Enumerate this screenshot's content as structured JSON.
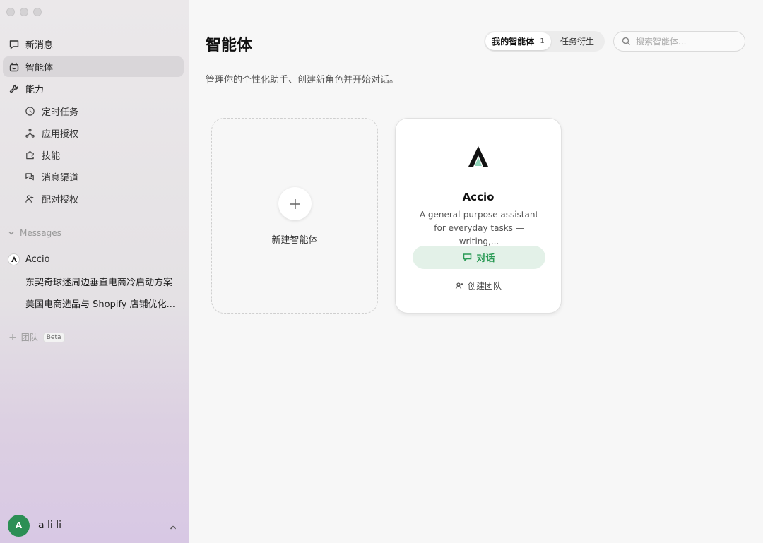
{
  "sidebar": {
    "nav": [
      {
        "label": "新消息",
        "icon": "chat-bubble-icon"
      },
      {
        "label": "智能体",
        "icon": "robot-icon",
        "active": true
      },
      {
        "label": "能力",
        "icon": "wrench-icon"
      }
    ],
    "sub": [
      {
        "label": "定时任务",
        "icon": "clock-icon"
      },
      {
        "label": "应用授权",
        "icon": "network-icon"
      },
      {
        "label": "技能",
        "icon": "puzzle-icon"
      },
      {
        "label": "消息渠道",
        "icon": "chat-double-icon"
      },
      {
        "label": "配对授权",
        "icon": "user-pair-icon"
      }
    ],
    "messages_header": "Messages",
    "messages": [
      {
        "label": "Accio",
        "avatar": "accio-logo-icon"
      },
      {
        "label": "东契奇球迷周边垂直电商冷启动方案"
      },
      {
        "label": "美国电商选品与 Shopify 店铺优化..."
      }
    ],
    "team": {
      "label": "团队",
      "badge": "Beta"
    },
    "user": {
      "initial": "A",
      "name": "a li li",
      "avatar_color": "#2c8f55"
    }
  },
  "main": {
    "title": "智能体",
    "subtitle": "管理你的个性化助手、创建新角色并开始对话。",
    "tabs": [
      {
        "label": "我的智能体",
        "count": "1",
        "active": true
      },
      {
        "label": "任务衍生"
      }
    ],
    "search": {
      "placeholder": "搜索智能体..."
    },
    "new_card": {
      "label": "新建智能体"
    },
    "agent_card": {
      "name": "Accio",
      "description": "A general-purpose assistant for everyday tasks — writing,...",
      "chat_label": "对话",
      "team_label": "创建团队",
      "accent_color": "#2a9a55"
    }
  }
}
